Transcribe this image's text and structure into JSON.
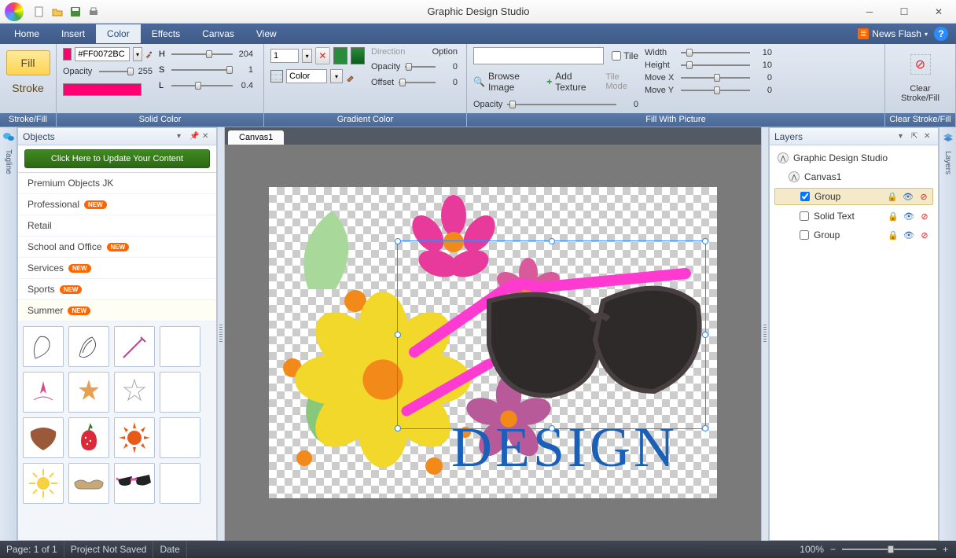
{
  "app": {
    "title": "Graphic Design Studio"
  },
  "menu": {
    "items": [
      "Home",
      "Insert",
      "Color",
      "Effects",
      "Canvas",
      "View"
    ],
    "active": "Color",
    "news": "News Flash"
  },
  "ribbon": {
    "strokefill": {
      "fill": "Fill",
      "stroke": "Stroke",
      "label": "Stroke/Fill"
    },
    "solid": {
      "label": "Solid Color",
      "hex": "#FF0072BC",
      "opacity_label": "Opacity",
      "opacity": "255",
      "h_label": "H",
      "h": "204",
      "s_label": "S",
      "s": "1",
      "l_label": "L",
      "l": "0.4"
    },
    "gradient": {
      "label": "Gradient Color",
      "stop": "1",
      "color_label": "Color",
      "direction": "Direction",
      "option": "Option",
      "opacity_label": "Opacity",
      "opacity": "0",
      "offset_label": "Offset",
      "offset": "0"
    },
    "picture": {
      "label": "Fill With Picture",
      "tile": "Tile",
      "browse": "Browse Image",
      "add": "Add Texture",
      "mode": "Tile Mode",
      "opacity_label": "Opacity",
      "opacity": "0",
      "width_label": "Width",
      "width": "10",
      "height_label": "Height",
      "height": "10",
      "movex_label": "Move X",
      "movex": "0",
      "movey_label": "Move Y",
      "movey": "0"
    },
    "clear": {
      "label": "Clear Stroke/Fill",
      "text": "Clear Stroke/Fill"
    }
  },
  "objects": {
    "title": "Objects",
    "update": "Click Here to Update Your Content",
    "categories": [
      {
        "label": "Premium Objects JK",
        "new": false
      },
      {
        "label": "Professional",
        "new": true
      },
      {
        "label": "Retail",
        "new": false
      },
      {
        "label": "School and Office",
        "new": true
      },
      {
        "label": "Services",
        "new": true
      },
      {
        "label": "Sports",
        "new": true
      },
      {
        "label": "Summer",
        "new": true
      }
    ],
    "new_badge": "NEW"
  },
  "tagline": "Tagline",
  "canvas": {
    "tab": "Canvas1",
    "design_text": "DESIGN"
  },
  "layers": {
    "title": "Layers",
    "tab": "Layers",
    "root": "Graphic Design Studio",
    "canvas": "Canvas1",
    "items": [
      {
        "label": "Group",
        "checked": true
      },
      {
        "label": "Solid Text",
        "checked": false
      },
      {
        "label": "Group",
        "checked": false
      }
    ]
  },
  "status": {
    "page": "Page: 1 of 1",
    "project": "Project Not Saved",
    "date": "Date",
    "zoom": "100%"
  }
}
